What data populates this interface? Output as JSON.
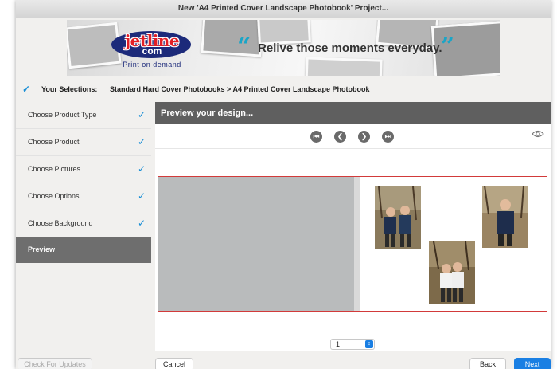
{
  "window": {
    "title": "New 'A4 Printed Cover Landscape Photobook' Project..."
  },
  "banner": {
    "logo_text": "jetline",
    "logo_sub": "com",
    "logo_tagline": "Print on demand",
    "open_quote": "“",
    "tagline": "Relive those moments everyday.",
    "close_quote": "”"
  },
  "selections": {
    "label": "Your Selections:",
    "path": "Standard Hard Cover Photobooks  >  A4 Printed Cover Landscape Photobook"
  },
  "sidebar": {
    "items": [
      {
        "label": "Choose Product Type",
        "done": true
      },
      {
        "label": "Choose Product",
        "done": true
      },
      {
        "label": "Choose Pictures",
        "done": true
      },
      {
        "label": "Choose Options",
        "done": true
      },
      {
        "label": "Choose Background",
        "done": true
      },
      {
        "label": "Preview",
        "done": false
      }
    ],
    "check_glyph": "✓"
  },
  "main": {
    "header": "Preview your design...",
    "nav": {
      "first": "⏮",
      "prev": "❮",
      "next": "❯",
      "last": "⏭"
    },
    "page_selector": {
      "value": "1"
    }
  },
  "footer": {
    "check_updates": "Check For Updates",
    "cancel": "Cancel",
    "back": "Back",
    "next": "Next"
  },
  "colors": {
    "accent": "#1a7fe3",
    "check": "#1a8fd6",
    "quote": "#1aa5c7",
    "header_bg": "#5f5f5f",
    "spread_border": "#d23a3a"
  }
}
